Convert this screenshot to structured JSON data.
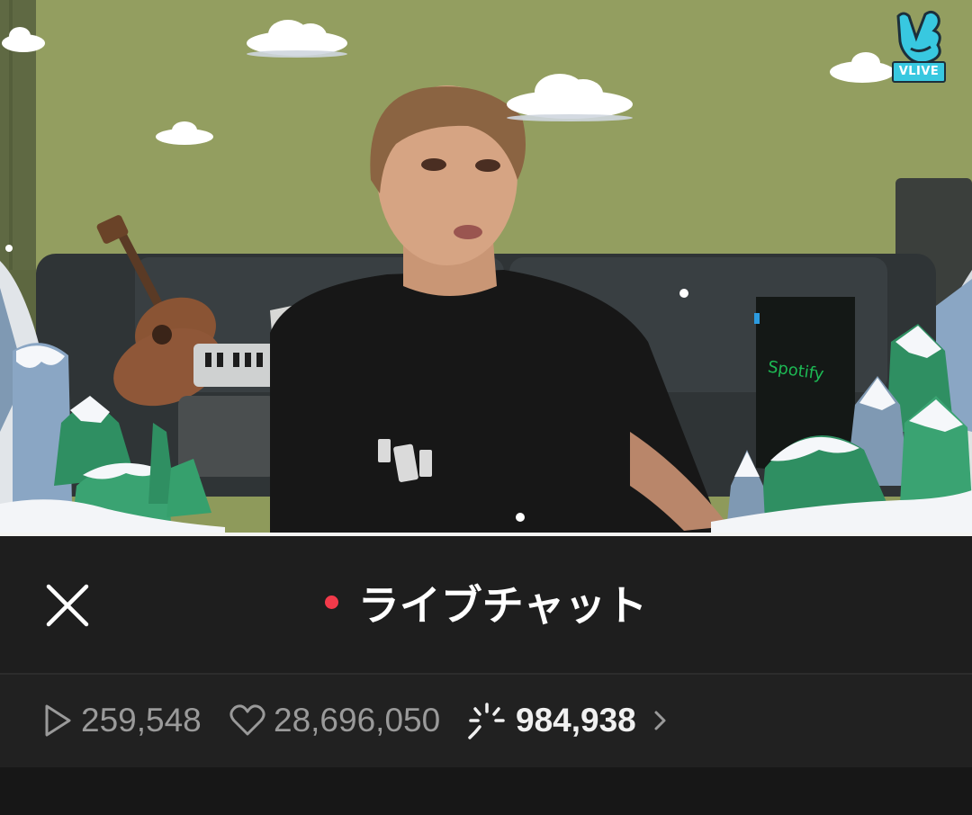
{
  "video": {
    "logo_text": "VLIVE"
  },
  "chat_header": {
    "title": "ライブチャット",
    "live_dot_color": "#f23a4a",
    "close_icon": "close-icon"
  },
  "stats": {
    "plays": "259,548",
    "likes": "28,696,050",
    "chat_count": "984,938",
    "play_icon": "play-icon",
    "heart_icon": "heart-icon",
    "chat_icon": "chat-burst-icon",
    "more_icon": "chevron-right-icon"
  }
}
